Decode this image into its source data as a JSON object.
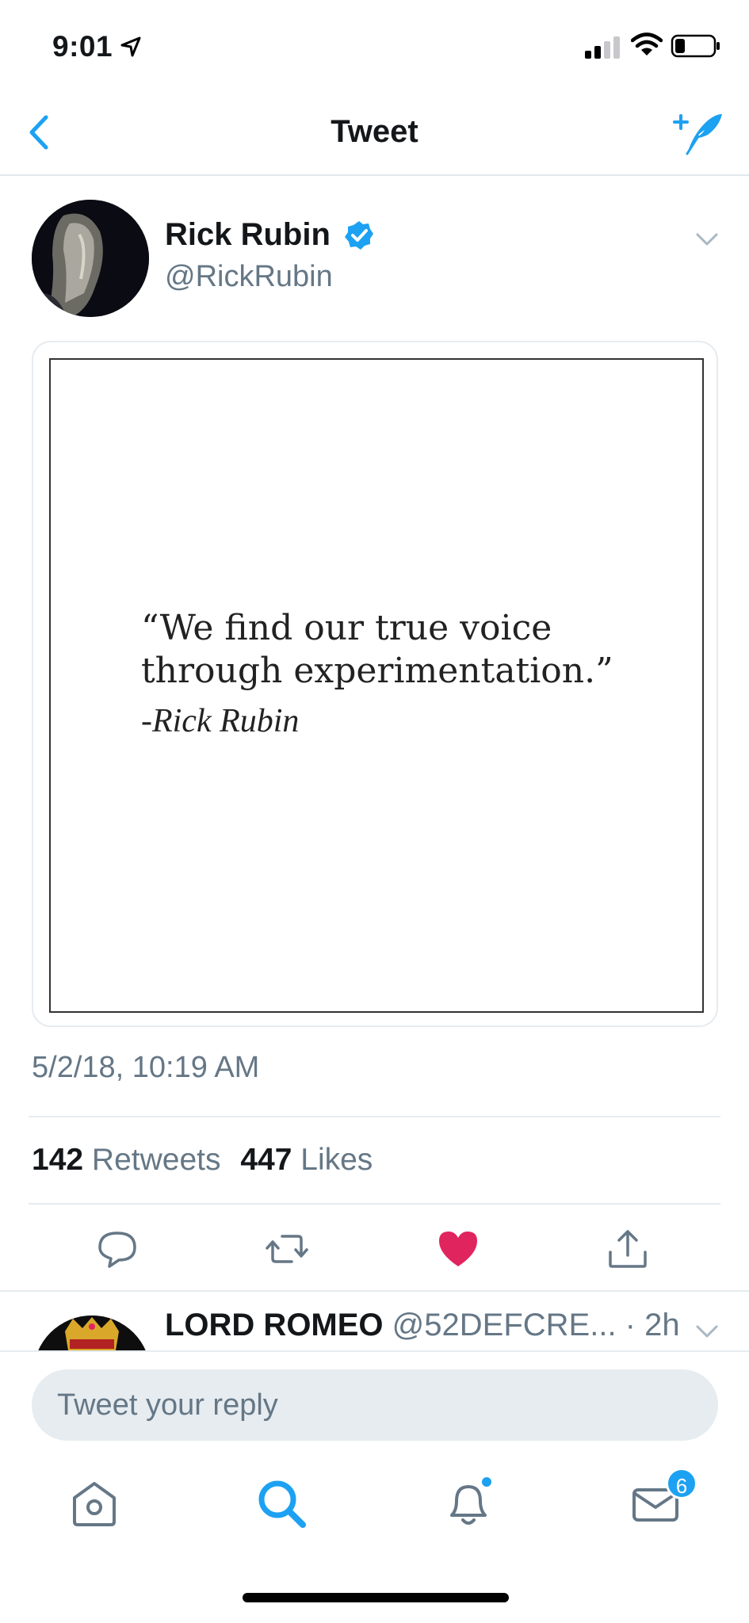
{
  "status_bar": {
    "time": "9:01"
  },
  "nav": {
    "title": "Tweet"
  },
  "tweet": {
    "author_name": "Rick Rubin",
    "author_handle": "@RickRubin",
    "quote_text": "“We find our true voice\nthrough experimentation.”",
    "quote_author": "-Rick Rubin",
    "timestamp": "5/2/18, 10:19 AM",
    "retweets_count": "142",
    "retweets_label": "Retweets",
    "likes_count": "447",
    "likes_label": "Likes",
    "liked": true
  },
  "reply_preview": {
    "name": "LORD ROMEO",
    "handle_time": " @52DEFCRE... · 2h"
  },
  "compose": {
    "placeholder": "Tweet your reply"
  },
  "tabbar": {
    "messages_badge": "6"
  },
  "colors": {
    "accent": "#1da1f2",
    "like": "#e0245e",
    "muted": "#657786"
  }
}
